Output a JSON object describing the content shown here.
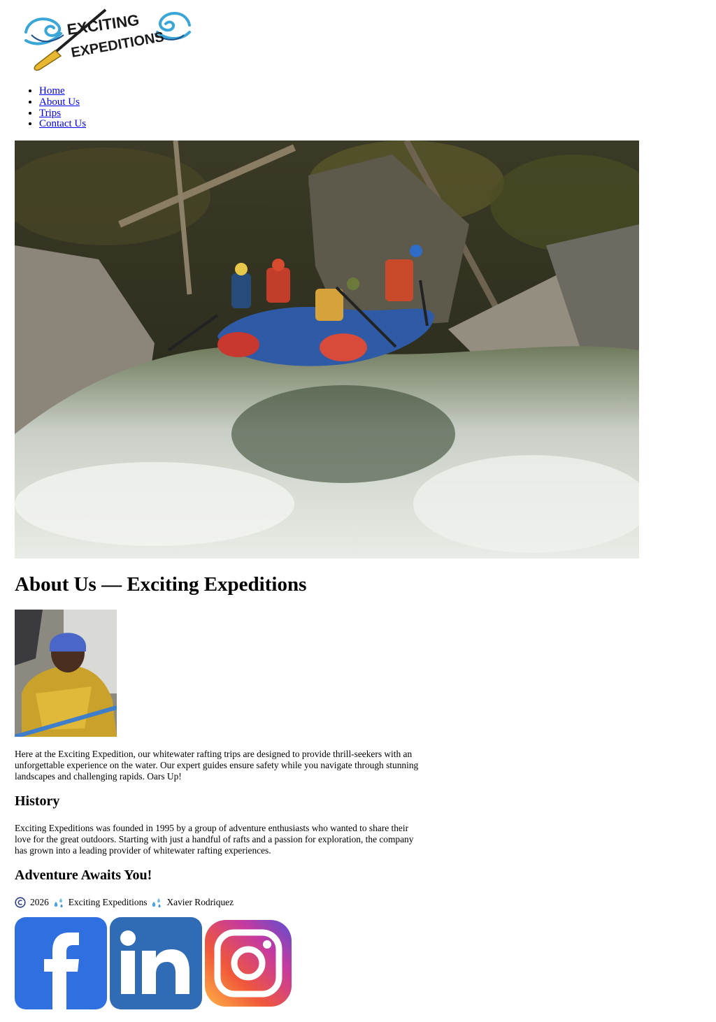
{
  "logo": {
    "line1": "EXCITING",
    "line2": "EXPEDITIONS"
  },
  "nav": {
    "items": [
      {
        "label": "Home"
      },
      {
        "label": "About Us"
      },
      {
        "label": "Trips"
      },
      {
        "label": "Contact Us"
      }
    ]
  },
  "main": {
    "title": "About Us — Exciting Expeditions",
    "intro": "Here at the Exciting Expedition, our whitewater rafting trips are designed to provide thrill-seekers with an unforgettable experience on the water. Our expert guides ensure safety while you navigate through stunning landscapes and challenging rapids. Oars Up!",
    "history_heading": "History",
    "history_text": "Exciting Expeditions was founded in 1995 by a group of adventure enthusiasts who wanted to share their love for the great outdoors. Starting with just a handful of rafts and a passion for exploration, the company has grown into a leading provider of whitewater rafting experiences.",
    "adventure_heading": "Adventure Awaits You!"
  },
  "footer": {
    "year": "2026",
    "company": "Exciting Expeditions",
    "author": "Xavier Rodriquez",
    "icons": [
      "copyright-icon",
      "droplets-icon"
    ]
  },
  "social": {
    "icons": [
      "facebook-icon",
      "linkedin-icon",
      "instagram-icon"
    ],
    "facebook_letter": "f",
    "linkedin_letters": "in"
  },
  "colors": {
    "link": "#0000ee",
    "logo_blue": "#3aa6d8",
    "logo_gold": "#e8b930",
    "facebook": "#2f6fe0",
    "linkedin": "#2f6cb5"
  }
}
